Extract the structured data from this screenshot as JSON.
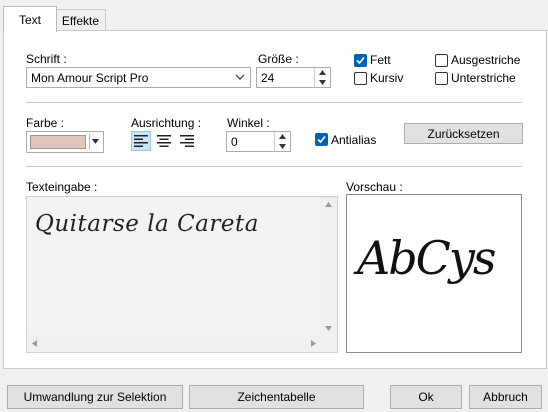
{
  "tabs": [
    {
      "label": "Text",
      "active": true
    },
    {
      "label": "Effekte",
      "active": false
    }
  ],
  "font": {
    "label": "Schrift :",
    "value": "Mon Amour Script Pro"
  },
  "size": {
    "label": "Größe :",
    "value": "24"
  },
  "styles": {
    "bold": {
      "label": "Fett",
      "checked": true
    },
    "italic": {
      "label": "Kursiv",
      "checked": false
    },
    "strikethrough": {
      "label": "Ausgestriche",
      "checked": false
    },
    "underline": {
      "label": "Unterstriche",
      "checked": false
    }
  },
  "color": {
    "label": "Farbe :",
    "swatch": "#dfc5bb"
  },
  "alignment": {
    "label": "Ausrichtung :",
    "options": [
      "left",
      "center",
      "right"
    ],
    "selected": "left"
  },
  "angle": {
    "label": "Winkel :",
    "value": "0"
  },
  "antialias": {
    "label": "Antialias",
    "checked": true
  },
  "reset_button": "Zurücksetzen",
  "text_input": {
    "label": "Texteingabe :",
    "content": "Quitarse la Careta"
  },
  "preview": {
    "label": "Vorschau :",
    "sample": "AbCys"
  },
  "footer": {
    "convert_button": "Umwandlung zur Selektion",
    "charmap_button": "Zeichentabelle",
    "ok_button": "Ok",
    "cancel_button": "Abbruch"
  },
  "colors": {
    "accent": "#0063b1",
    "selected_align_bg": "#cce4f7"
  }
}
